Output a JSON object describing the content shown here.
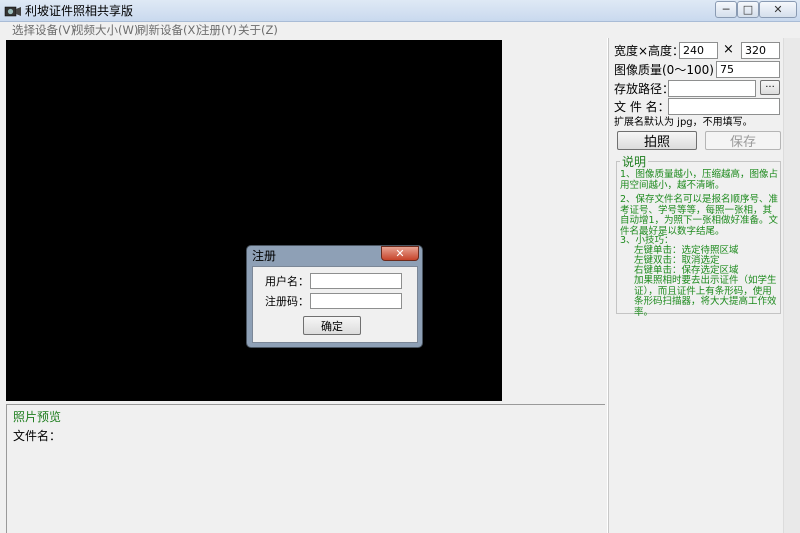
{
  "window": {
    "title": "利坡证件照相共享版",
    "minimize_glyph": "─",
    "maximize_glyph": "□",
    "close_glyph": "✕"
  },
  "menu": [
    {
      "label": "选择设备(V)"
    },
    {
      "label": "视频大小(W)"
    },
    {
      "label": "刷新设备(X)"
    },
    {
      "label": "注册(Y)"
    },
    {
      "label": "关于(Z)"
    }
  ],
  "settings": {
    "size_label": "宽度×高度：",
    "width_value": "240",
    "times_sign": "×",
    "height_value": "320",
    "quality_label": "图像质量(0～100)：",
    "quality_value": "75",
    "path_label": "存放路径：",
    "path_value": "",
    "browse_label": "···",
    "filename_label": "文 件 名：",
    "filename_value": "",
    "ext_note": "扩展名默认为 jpg，不用填写。",
    "capture_label": "拍照",
    "save_label": "保存"
  },
  "info": {
    "title": "说明",
    "p1": "1、图像质量越小，压缩越高，图像占用空间越小，越不清晰。",
    "p2": "2、保存文件名可以是报名顺序号、准考证号、学号等等，每照一张相，其自动增1，为照下一张相做好准备。文件名最好是以数字结尾。",
    "p3_title": "3、小技巧：",
    "p3_lines": [
      "左键单击：选定待照区域",
      "左键双击：取消选定",
      "右键单击：保存选定区域"
    ],
    "p3_tail": "加果照相时要去出示证件（如学生证），而且证件上有条形码，使用条形码扫描器，将大大提高工作效率。"
  },
  "preview": {
    "title": "照片预览",
    "file_label": "文件名："
  },
  "dialog": {
    "title": "注册",
    "close_glyph": "✕",
    "username_label": "用户名：",
    "username_value": "",
    "code_label": "注册码：",
    "code_value": "",
    "ok_label": "确定"
  }
}
